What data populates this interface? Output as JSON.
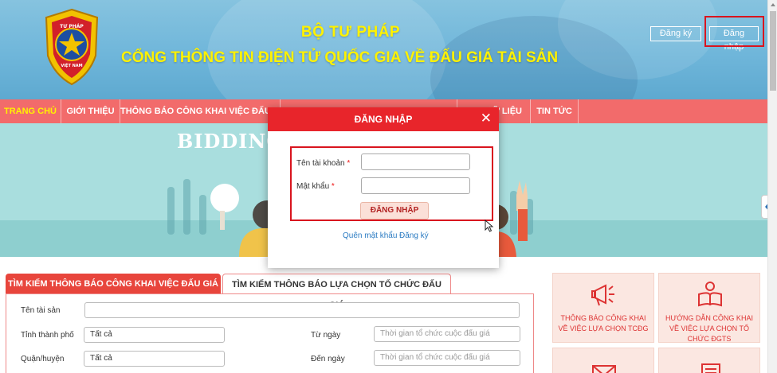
{
  "header": {
    "title1": "BỘ TƯ PHÁP",
    "title2": "CỔNG THÔNG TIN ĐIỆN TỬ QUỐC GIA VỀ ĐẤU GIÁ TÀI SẢN",
    "register_label": "Đăng ký",
    "login_label": "Đăng nhập",
    "logo_text_top": "TƯ PHÁP",
    "logo_text_bottom": "VIỆT NAM"
  },
  "nav": {
    "items": [
      {
        "label": "TRANG CHỦ",
        "active": true
      },
      {
        "label": "GIỚI THIỆU"
      },
      {
        "label": "THÔNG BÁO CÔNG KHAI VIỆC ĐẤU GIÁ"
      },
      {
        "label": ""
      },
      {
        "label": "Ữ LIỆU"
      },
      {
        "label": "TIN TỨC"
      }
    ]
  },
  "banner": {
    "text": "BIDDING"
  },
  "modal": {
    "title": "ĐĂNG NHẬP",
    "close": "✕",
    "username_label": "Tên tài khoản",
    "password_label": "Mật khẩu",
    "required_mark": "*",
    "username_value": "",
    "password_value": "",
    "submit_label": "ĐĂNG NHẬP",
    "forgot_label": "Quên mật khẩu",
    "register_label": "Đăng ký"
  },
  "search": {
    "tab_active": "TÌM KIẾM THÔNG BÁO CÔNG KHAI VIỆC ĐẤU GIÁ",
    "tab_inactive": "TÌM KIẾM THÔNG BÁO LỰA CHỌN TỔ CHỨC ĐẤU GIÁ",
    "asset_name_label": "Tên tài sản",
    "asset_name_value": "",
    "province_label": "Tỉnh thành phố",
    "province_value": "Tất cả",
    "district_label": "Quận/huyện",
    "district_value": "Tất cả",
    "from_date_label": "Từ ngày",
    "from_date_placeholder": "Thời gian tổ chức cuộc đấu giá",
    "to_date_label": "Đến ngày",
    "to_date_placeholder": "Thời gian tổ chức cuộc đấu giá"
  },
  "cards": [
    {
      "label": "THÔNG BÁO CÔNG KHAI VỀ VIỆC LỰA CHỌN TCĐG",
      "icon": "megaphone-icon"
    },
    {
      "label": "HƯỚNG DẪN CÔNG KHAI VỀ VIỆC LỰA CHỌN TỔ CHỨC ĐGTS",
      "icon": "reading-person-icon"
    },
    {
      "label": "",
      "icon": "envelope-icon"
    },
    {
      "label": "",
      "icon": "document-icon"
    }
  ],
  "colors": {
    "header_title": "#fff200",
    "nav_bg": "#f26b6b",
    "modal_header": "#e8252b",
    "highlight": "#d9141e",
    "tab_active": "#e8453c",
    "card_bg": "#fbe7e1"
  }
}
